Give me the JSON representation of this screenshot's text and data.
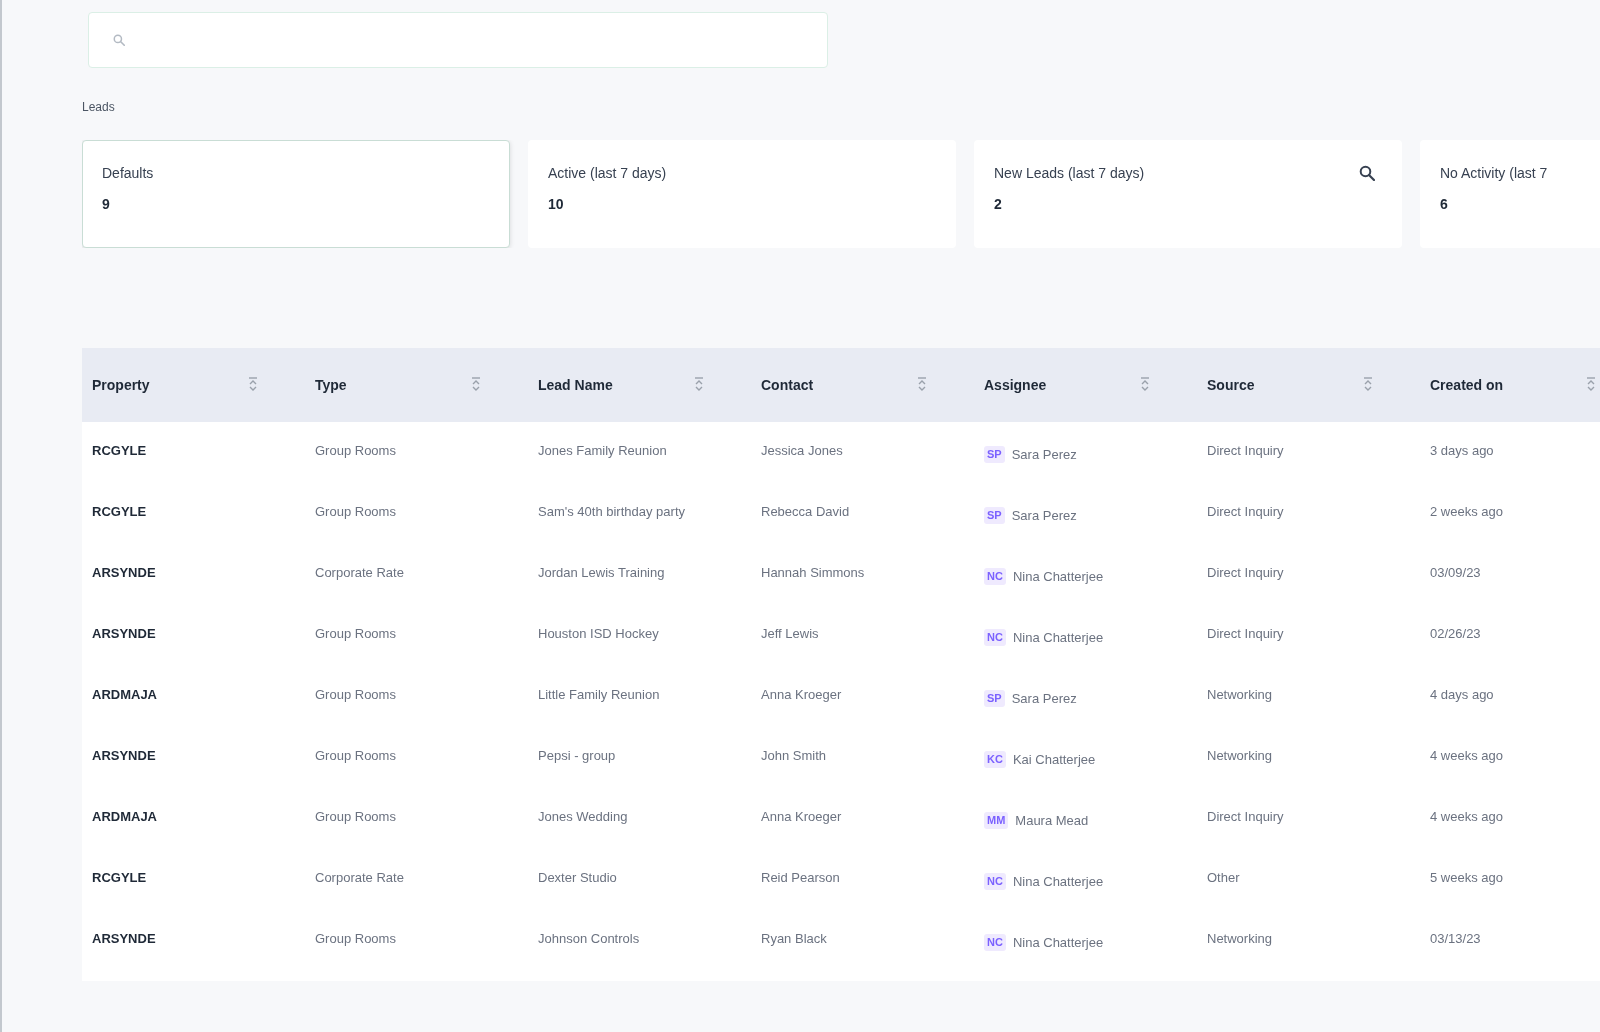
{
  "leads_label": "Leads",
  "filter_cards": [
    {
      "label": "Defaults",
      "count": "9",
      "selected": true,
      "kind": "plain"
    },
    {
      "label": "Active (last 7 days)",
      "count": "10",
      "selected": false,
      "kind": "plain"
    },
    {
      "label": "New Leads (last 7 days)",
      "count": "2",
      "selected": false,
      "kind": "search"
    },
    {
      "label": "No Activity (last 7",
      "count": "6",
      "selected": false,
      "kind": "plain"
    }
  ],
  "table": {
    "columns": [
      "Property",
      "Type",
      "Lead Name",
      "Contact",
      "Assignee",
      "Source",
      "Created on"
    ],
    "rows": [
      {
        "property": "RCGYLE",
        "type": "Group Rooms",
        "lead_name": "Jones Family Reunion",
        "contact": "Jessica Jones",
        "assignee": {
          "initials": "SP",
          "name": "Sara Perez"
        },
        "source": "Direct Inquiry",
        "created_on": "3 days ago"
      },
      {
        "property": "RCGYLE",
        "type": "Group Rooms",
        "lead_name": "Sam's 40th birthday party",
        "contact": "Rebecca David",
        "assignee": {
          "initials": "SP",
          "name": "Sara Perez"
        },
        "source": "Direct Inquiry",
        "created_on": "2 weeks ago"
      },
      {
        "property": "ARSYNDE",
        "type": "Corporate Rate",
        "lead_name": "Jordan Lewis Training",
        "contact": "Hannah Simmons",
        "assignee": {
          "initials": "NC",
          "name": "Nina Chatterjee"
        },
        "source": "Direct Inquiry",
        "created_on": "03/09/23"
      },
      {
        "property": "ARSYNDE",
        "type": "Group Rooms",
        "lead_name": "Houston ISD Hockey",
        "contact": "Jeff Lewis",
        "assignee": {
          "initials": "NC",
          "name": "Nina Chatterjee"
        },
        "source": "Direct Inquiry",
        "created_on": "02/26/23"
      },
      {
        "property": "ARDMAJA",
        "type": "Group Rooms",
        "lead_name": "Little Family Reunion",
        "contact": "Anna Kroeger",
        "assignee": {
          "initials": "SP",
          "name": "Sara Perez"
        },
        "source": "Networking",
        "created_on": "4 days ago"
      },
      {
        "property": "ARSYNDE",
        "type": "Group Rooms",
        "lead_name": "Pepsi - group",
        "contact": "John Smith",
        "assignee": {
          "initials": "KC",
          "name": "Kai Chatterjee"
        },
        "source": "Networking",
        "created_on": "4 weeks ago"
      },
      {
        "property": "ARDMAJA",
        "type": "Group Rooms",
        "lead_name": "Jones Wedding",
        "contact": "Anna Kroeger",
        "assignee": {
          "initials": "MM",
          "name": "Maura Mead"
        },
        "source": "Direct Inquiry",
        "created_on": "4 weeks ago"
      },
      {
        "property": "RCGYLE",
        "type": "Corporate Rate",
        "lead_name": "Dexter Studio",
        "contact": "Reid Pearson",
        "assignee": {
          "initials": "NC",
          "name": "Nina Chatterjee"
        },
        "source": "Other",
        "created_on": "5 weeks ago"
      },
      {
        "property": "ARSYNDE",
        "type": "Group Rooms",
        "lead_name": "Johnson Controls",
        "contact": "Ryan Black",
        "assignee": {
          "initials": "NC",
          "name": "Nina Chatterjee"
        },
        "source": "Networking",
        "created_on": "03/13/23"
      }
    ]
  }
}
